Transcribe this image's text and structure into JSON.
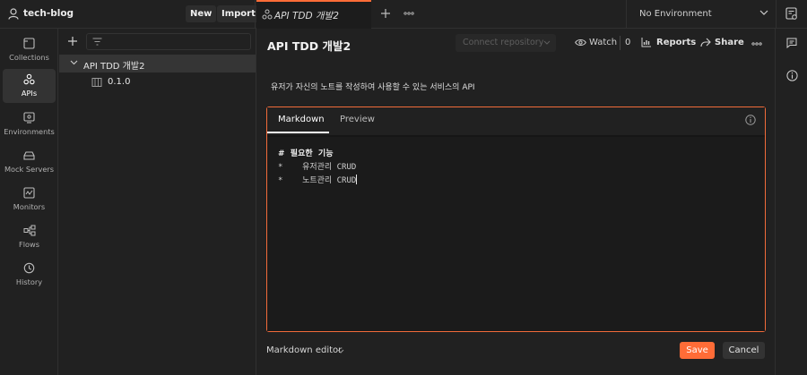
{
  "topbar": {
    "workspace_name": "tech-blog",
    "new_label": "New",
    "import_label": "Import",
    "active_tab_label": "API TDD 개발2",
    "environment_label": "No Environment"
  },
  "sidebar": {
    "items": [
      {
        "label": "Collections",
        "icon": "collections-icon"
      },
      {
        "label": "APIs",
        "icon": "apis-icon",
        "active": true
      },
      {
        "label": "Environments",
        "icon": "environments-icon"
      },
      {
        "label": "Mock Servers",
        "icon": "mock-servers-icon"
      },
      {
        "label": "Monitors",
        "icon": "monitors-icon"
      },
      {
        "label": "Flows",
        "icon": "flows-icon"
      },
      {
        "label": "History",
        "icon": "history-icon"
      }
    ]
  },
  "tree": {
    "api_name": "API TDD 개발2",
    "version": "0.1.0"
  },
  "main": {
    "title": "API TDD 개발2",
    "connect_repo": "Connect repository",
    "watch_label": "Watch",
    "watch_count": "0",
    "reports_label": "Reports",
    "share_label": "Share",
    "description": "유저가 자신의 노트를 작성하여 사용할 수 있는 서비스의 API",
    "editor": {
      "tab_markdown": "Markdown",
      "tab_preview": "Preview",
      "line1": "#  필요한  기능",
      "line2": "*    유저관리 CRUD",
      "line3": "*    노트관리 CRUD"
    },
    "footer": {
      "editor_mode": "Markdown editor",
      "save_label": "Save",
      "cancel_label": "Cancel"
    }
  },
  "colors": {
    "accent": "#ff6c37",
    "background": "#212121",
    "editor_bg": "#1b1b1b"
  }
}
